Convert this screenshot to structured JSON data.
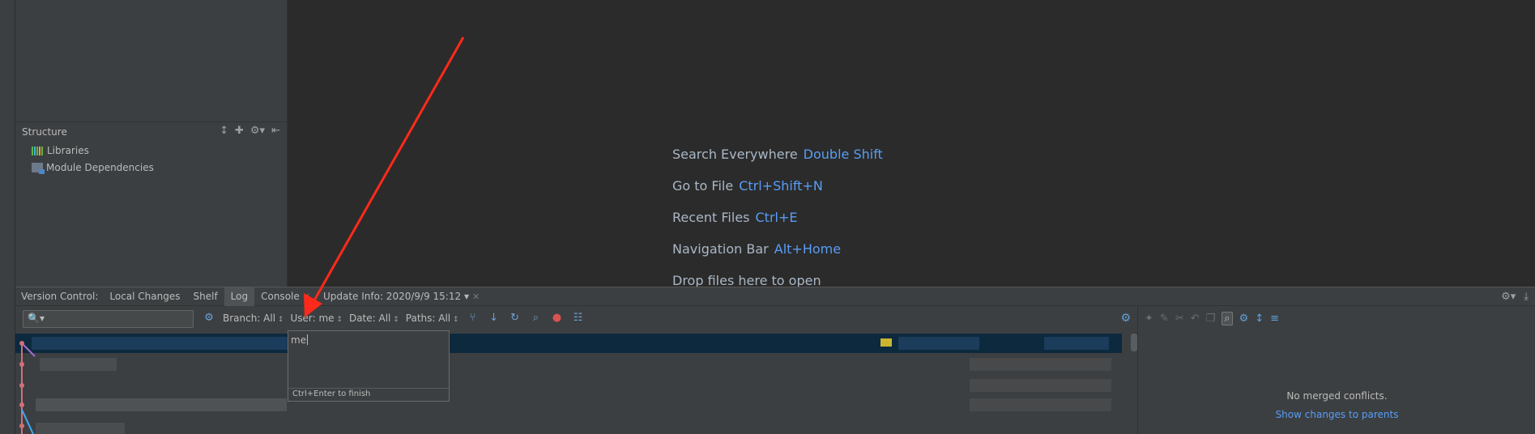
{
  "structure": {
    "title": "Structure",
    "items": [
      {
        "label": "Libraries"
      },
      {
        "label": "Module Dependencies"
      }
    ]
  },
  "welcome": {
    "hints": [
      {
        "label": "Search Everywhere",
        "shortcut": "Double Shift"
      },
      {
        "label": "Go to File",
        "shortcut": "Ctrl+Shift+N"
      },
      {
        "label": "Recent Files",
        "shortcut": "Ctrl+E"
      },
      {
        "label": "Navigation Bar",
        "shortcut": "Alt+Home"
      },
      {
        "label": "Drop files here to open",
        "shortcut": ""
      }
    ]
  },
  "vc": {
    "label": "Version Control:",
    "tabs": [
      {
        "label": "Local Changes"
      },
      {
        "label": "Shelf"
      },
      {
        "label": "Log"
      },
      {
        "label": "Console"
      },
      {
        "label": "Update Info: 2020/9/9 15:12"
      }
    ]
  },
  "log": {
    "filters": {
      "branch": "Branch: All",
      "user": "User: me",
      "date": "Date: All",
      "paths": "Paths: All"
    }
  },
  "user_popup": {
    "value": "me",
    "hint": "Ctrl+Enter to finish"
  },
  "merge": {
    "empty_text": "No merged conflicts.",
    "link": "Show changes to parents"
  },
  "colors": {
    "background": "#2b2b2b",
    "panel": "#3c3f41",
    "accent_link": "#589df6",
    "selection": "#0d293e",
    "annotation_arrow": "#ff2a1a"
  }
}
